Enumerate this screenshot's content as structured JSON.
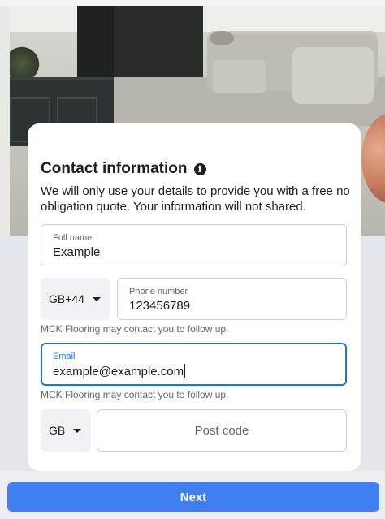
{
  "form": {
    "title": "Contact information",
    "description": "We will only use your details to provide you with a free no obligation quote. Your information will not shared.",
    "full_name": {
      "label": "Full name",
      "value": "Example"
    },
    "phone": {
      "country_code": "GB+44",
      "label": "Phone number",
      "value": "123456789"
    },
    "phone_helper": "MCK Flooring may contact you to follow up.",
    "email": {
      "label": "Email",
      "value": "example@example.com"
    },
    "email_helper": "MCK Flooring may contact you to follow up.",
    "postcode": {
      "country": "GB",
      "placeholder": "Post code"
    }
  },
  "actions": {
    "next_label": "Next"
  },
  "colors": {
    "primary": "#3f7ff0",
    "focus": "#1b74e4"
  },
  "icons": {
    "title_info": "info-icon",
    "dropdown": "chevron-down-icon"
  }
}
